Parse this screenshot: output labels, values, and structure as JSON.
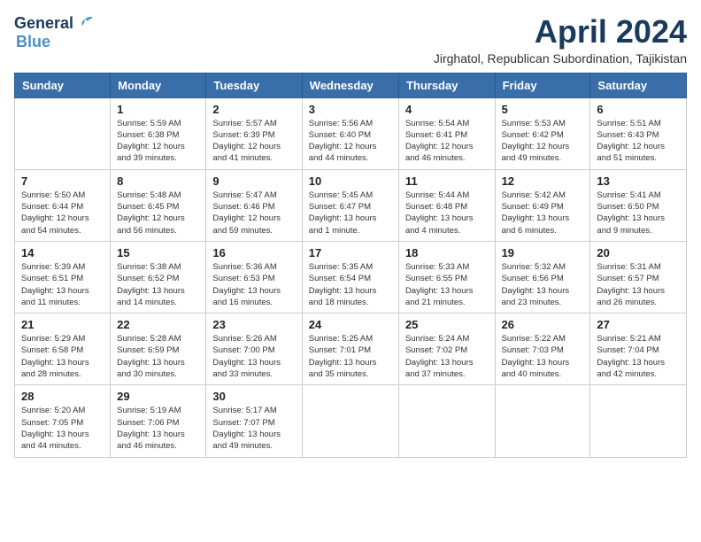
{
  "logo": {
    "line1": "General",
    "line2": "Blue"
  },
  "title": "April 2024",
  "location": "Jirghatol, Republican Subordination, Tajikistan",
  "headers": [
    "Sunday",
    "Monday",
    "Tuesday",
    "Wednesday",
    "Thursday",
    "Friday",
    "Saturday"
  ],
  "weeks": [
    [
      {
        "day": "",
        "info": ""
      },
      {
        "day": "1",
        "info": "Sunrise: 5:59 AM\nSunset: 6:38 PM\nDaylight: 12 hours\nand 39 minutes."
      },
      {
        "day": "2",
        "info": "Sunrise: 5:57 AM\nSunset: 6:39 PM\nDaylight: 12 hours\nand 41 minutes."
      },
      {
        "day": "3",
        "info": "Sunrise: 5:56 AM\nSunset: 6:40 PM\nDaylight: 12 hours\nand 44 minutes."
      },
      {
        "day": "4",
        "info": "Sunrise: 5:54 AM\nSunset: 6:41 PM\nDaylight: 12 hours\nand 46 minutes."
      },
      {
        "day": "5",
        "info": "Sunrise: 5:53 AM\nSunset: 6:42 PM\nDaylight: 12 hours\nand 49 minutes."
      },
      {
        "day": "6",
        "info": "Sunrise: 5:51 AM\nSunset: 6:43 PM\nDaylight: 12 hours\nand 51 minutes."
      }
    ],
    [
      {
        "day": "7",
        "info": "Sunrise: 5:50 AM\nSunset: 6:44 PM\nDaylight: 12 hours\nand 54 minutes."
      },
      {
        "day": "8",
        "info": "Sunrise: 5:48 AM\nSunset: 6:45 PM\nDaylight: 12 hours\nand 56 minutes."
      },
      {
        "day": "9",
        "info": "Sunrise: 5:47 AM\nSunset: 6:46 PM\nDaylight: 12 hours\nand 59 minutes."
      },
      {
        "day": "10",
        "info": "Sunrise: 5:45 AM\nSunset: 6:47 PM\nDaylight: 13 hours\nand 1 minute."
      },
      {
        "day": "11",
        "info": "Sunrise: 5:44 AM\nSunset: 6:48 PM\nDaylight: 13 hours\nand 4 minutes."
      },
      {
        "day": "12",
        "info": "Sunrise: 5:42 AM\nSunset: 6:49 PM\nDaylight: 13 hours\nand 6 minutes."
      },
      {
        "day": "13",
        "info": "Sunrise: 5:41 AM\nSunset: 6:50 PM\nDaylight: 13 hours\nand 9 minutes."
      }
    ],
    [
      {
        "day": "14",
        "info": "Sunrise: 5:39 AM\nSunset: 6:51 PM\nDaylight: 13 hours\nand 11 minutes."
      },
      {
        "day": "15",
        "info": "Sunrise: 5:38 AM\nSunset: 6:52 PM\nDaylight: 13 hours\nand 14 minutes."
      },
      {
        "day": "16",
        "info": "Sunrise: 5:36 AM\nSunset: 6:53 PM\nDaylight: 13 hours\nand 16 minutes."
      },
      {
        "day": "17",
        "info": "Sunrise: 5:35 AM\nSunset: 6:54 PM\nDaylight: 13 hours\nand 18 minutes."
      },
      {
        "day": "18",
        "info": "Sunrise: 5:33 AM\nSunset: 6:55 PM\nDaylight: 13 hours\nand 21 minutes."
      },
      {
        "day": "19",
        "info": "Sunrise: 5:32 AM\nSunset: 6:56 PM\nDaylight: 13 hours\nand 23 minutes."
      },
      {
        "day": "20",
        "info": "Sunrise: 5:31 AM\nSunset: 6:57 PM\nDaylight: 13 hours\nand 26 minutes."
      }
    ],
    [
      {
        "day": "21",
        "info": "Sunrise: 5:29 AM\nSunset: 6:58 PM\nDaylight: 13 hours\nand 28 minutes."
      },
      {
        "day": "22",
        "info": "Sunrise: 5:28 AM\nSunset: 6:59 PM\nDaylight: 13 hours\nand 30 minutes."
      },
      {
        "day": "23",
        "info": "Sunrise: 5:26 AM\nSunset: 7:00 PM\nDaylight: 13 hours\nand 33 minutes."
      },
      {
        "day": "24",
        "info": "Sunrise: 5:25 AM\nSunset: 7:01 PM\nDaylight: 13 hours\nand 35 minutes."
      },
      {
        "day": "25",
        "info": "Sunrise: 5:24 AM\nSunset: 7:02 PM\nDaylight: 13 hours\nand 37 minutes."
      },
      {
        "day": "26",
        "info": "Sunrise: 5:22 AM\nSunset: 7:03 PM\nDaylight: 13 hours\nand 40 minutes."
      },
      {
        "day": "27",
        "info": "Sunrise: 5:21 AM\nSunset: 7:04 PM\nDaylight: 13 hours\nand 42 minutes."
      }
    ],
    [
      {
        "day": "28",
        "info": "Sunrise: 5:20 AM\nSunset: 7:05 PM\nDaylight: 13 hours\nand 44 minutes."
      },
      {
        "day": "29",
        "info": "Sunrise: 5:19 AM\nSunset: 7:06 PM\nDaylight: 13 hours\nand 46 minutes."
      },
      {
        "day": "30",
        "info": "Sunrise: 5:17 AM\nSunset: 7:07 PM\nDaylight: 13 hours\nand 49 minutes."
      },
      {
        "day": "",
        "info": ""
      },
      {
        "day": "",
        "info": ""
      },
      {
        "day": "",
        "info": ""
      },
      {
        "day": "",
        "info": ""
      }
    ]
  ]
}
